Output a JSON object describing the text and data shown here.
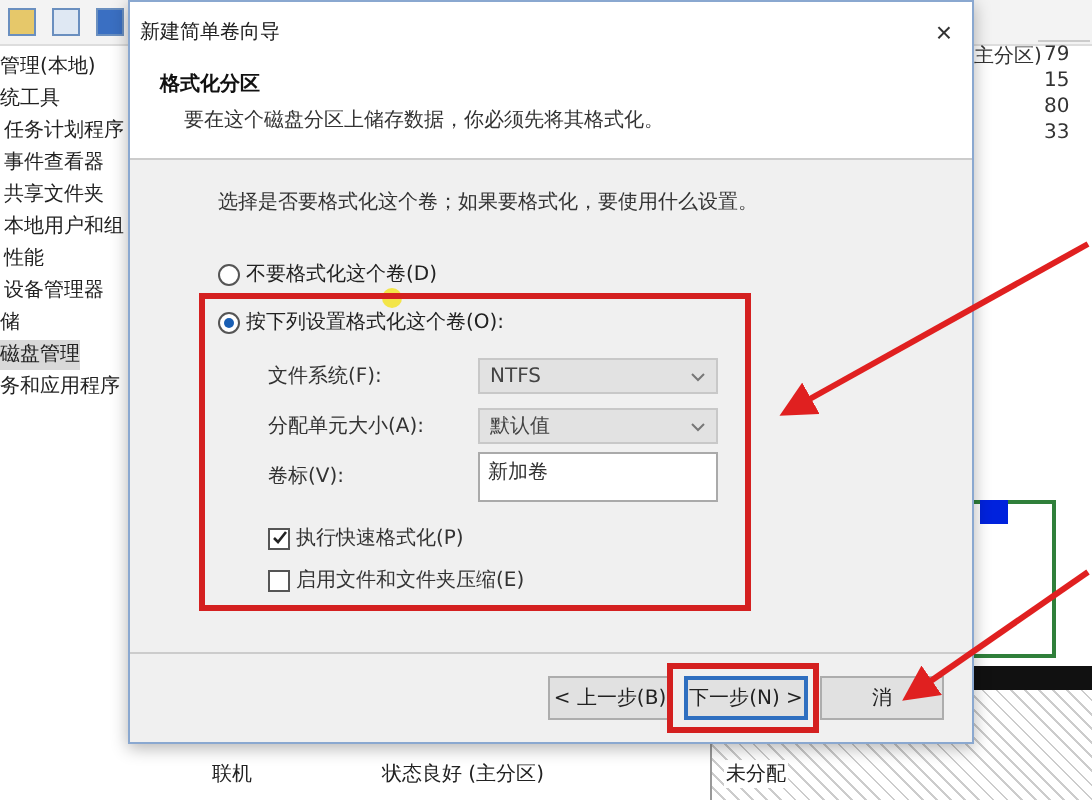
{
  "console": {
    "tree": [
      {
        "label": "管理(本地)",
        "selected": false
      },
      {
        "label": "统工具",
        "selected": false
      },
      {
        "label": "任务计划程序",
        "selected": false
      },
      {
        "label": "事件查看器",
        "selected": false
      },
      {
        "label": "共享文件夹",
        "selected": false
      },
      {
        "label": "本地用户和组",
        "selected": false
      },
      {
        "label": "性能",
        "selected": false
      },
      {
        "label": "设备管理器",
        "selected": false
      },
      {
        "label": "储",
        "selected": false
      },
      {
        "label": "磁盘管理",
        "selected": true
      },
      {
        "label": "务和应用程序",
        "selected": false
      }
    ],
    "volume_table": {
      "layout_cell": "主分区)",
      "column_2": [
        "79",
        "15",
        "80",
        "33"
      ]
    },
    "disk_rows": [
      {
        "status": "联机",
        "partition": "状态良好 (主分区)",
        "unallocated": "未分配"
      }
    ]
  },
  "dialog": {
    "title": "新建简单卷向导",
    "close": "×",
    "heading": "格式化分区",
    "subheading": "要在这个磁盘分区上储存数据，你必须先将其格式化。",
    "instruction": "选择是否要格式化这个卷；如果要格式化，要使用什么设置。",
    "options": [
      {
        "label": "不要格式化这个卷(D)",
        "selected": false
      },
      {
        "label": "按下列设置格式化这个卷(O):",
        "selected": true
      }
    ],
    "fields": [
      {
        "kind": "select",
        "label": "文件系统(F):",
        "value": "NTFS"
      },
      {
        "kind": "select",
        "label": "分配单元大小(A):",
        "value": "默认值"
      },
      {
        "kind": "input",
        "label": "卷标(V):",
        "value": "新加卷"
      }
    ],
    "checkboxes": [
      {
        "label": "执行快速格式化(P)",
        "checked": true
      },
      {
        "label": "启用文件和文件夹压缩(E)",
        "checked": false
      }
    ],
    "buttons": [
      {
        "label": "< 上一步(B)",
        "selected": false
      },
      {
        "label": "下一步(N) >",
        "selected": true
      },
      {
        "label": "消",
        "selected": false
      }
    ]
  }
}
